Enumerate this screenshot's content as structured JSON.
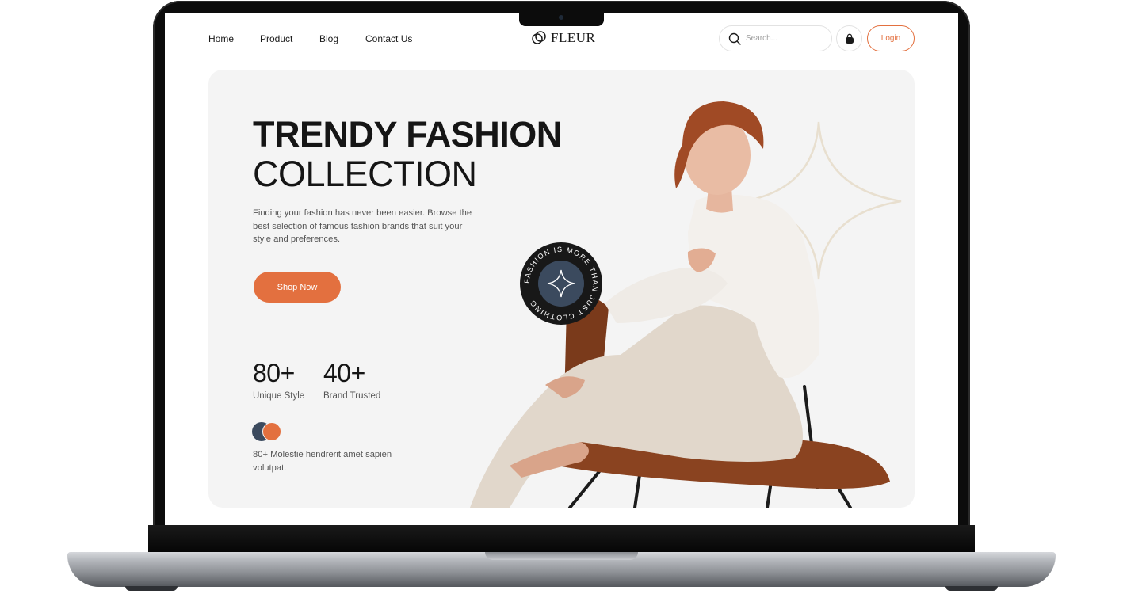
{
  "nav": {
    "links": [
      "Home",
      "Product",
      "Blog",
      "Contact Us"
    ]
  },
  "brand": {
    "name": "FLEUR"
  },
  "search": {
    "placeholder": "Search..."
  },
  "actions": {
    "login_label": "Login"
  },
  "hero": {
    "title_line1": "TRENDY FASHION",
    "title_line2": "COLLECTION",
    "description": "Finding your fashion has never been easier. Browse the best selection of famous fashion brands that suit your style and preferences.",
    "cta_label": "Shop Now",
    "stats": [
      {
        "value": "80+",
        "label": "Unique Style"
      },
      {
        "value": "40+",
        "label": "Brand Trusted"
      }
    ],
    "testimonial": "80+ Molestie hendrerit amet sapien volutpat.",
    "badge_text": "FASHION IS MORE THAN JUST CLOTHING"
  },
  "colors": {
    "accent": "#e3703f",
    "slate": "#3b4a5e",
    "hero_bg": "#f4f4f4",
    "text_dark": "#151515"
  },
  "icons": {
    "logo": "interlocking-rings-icon",
    "search": "search-icon",
    "cart": "shopping-bag-icon",
    "badge": "four-point-star-icon",
    "decoration": "four-point-star-outline-icon"
  }
}
